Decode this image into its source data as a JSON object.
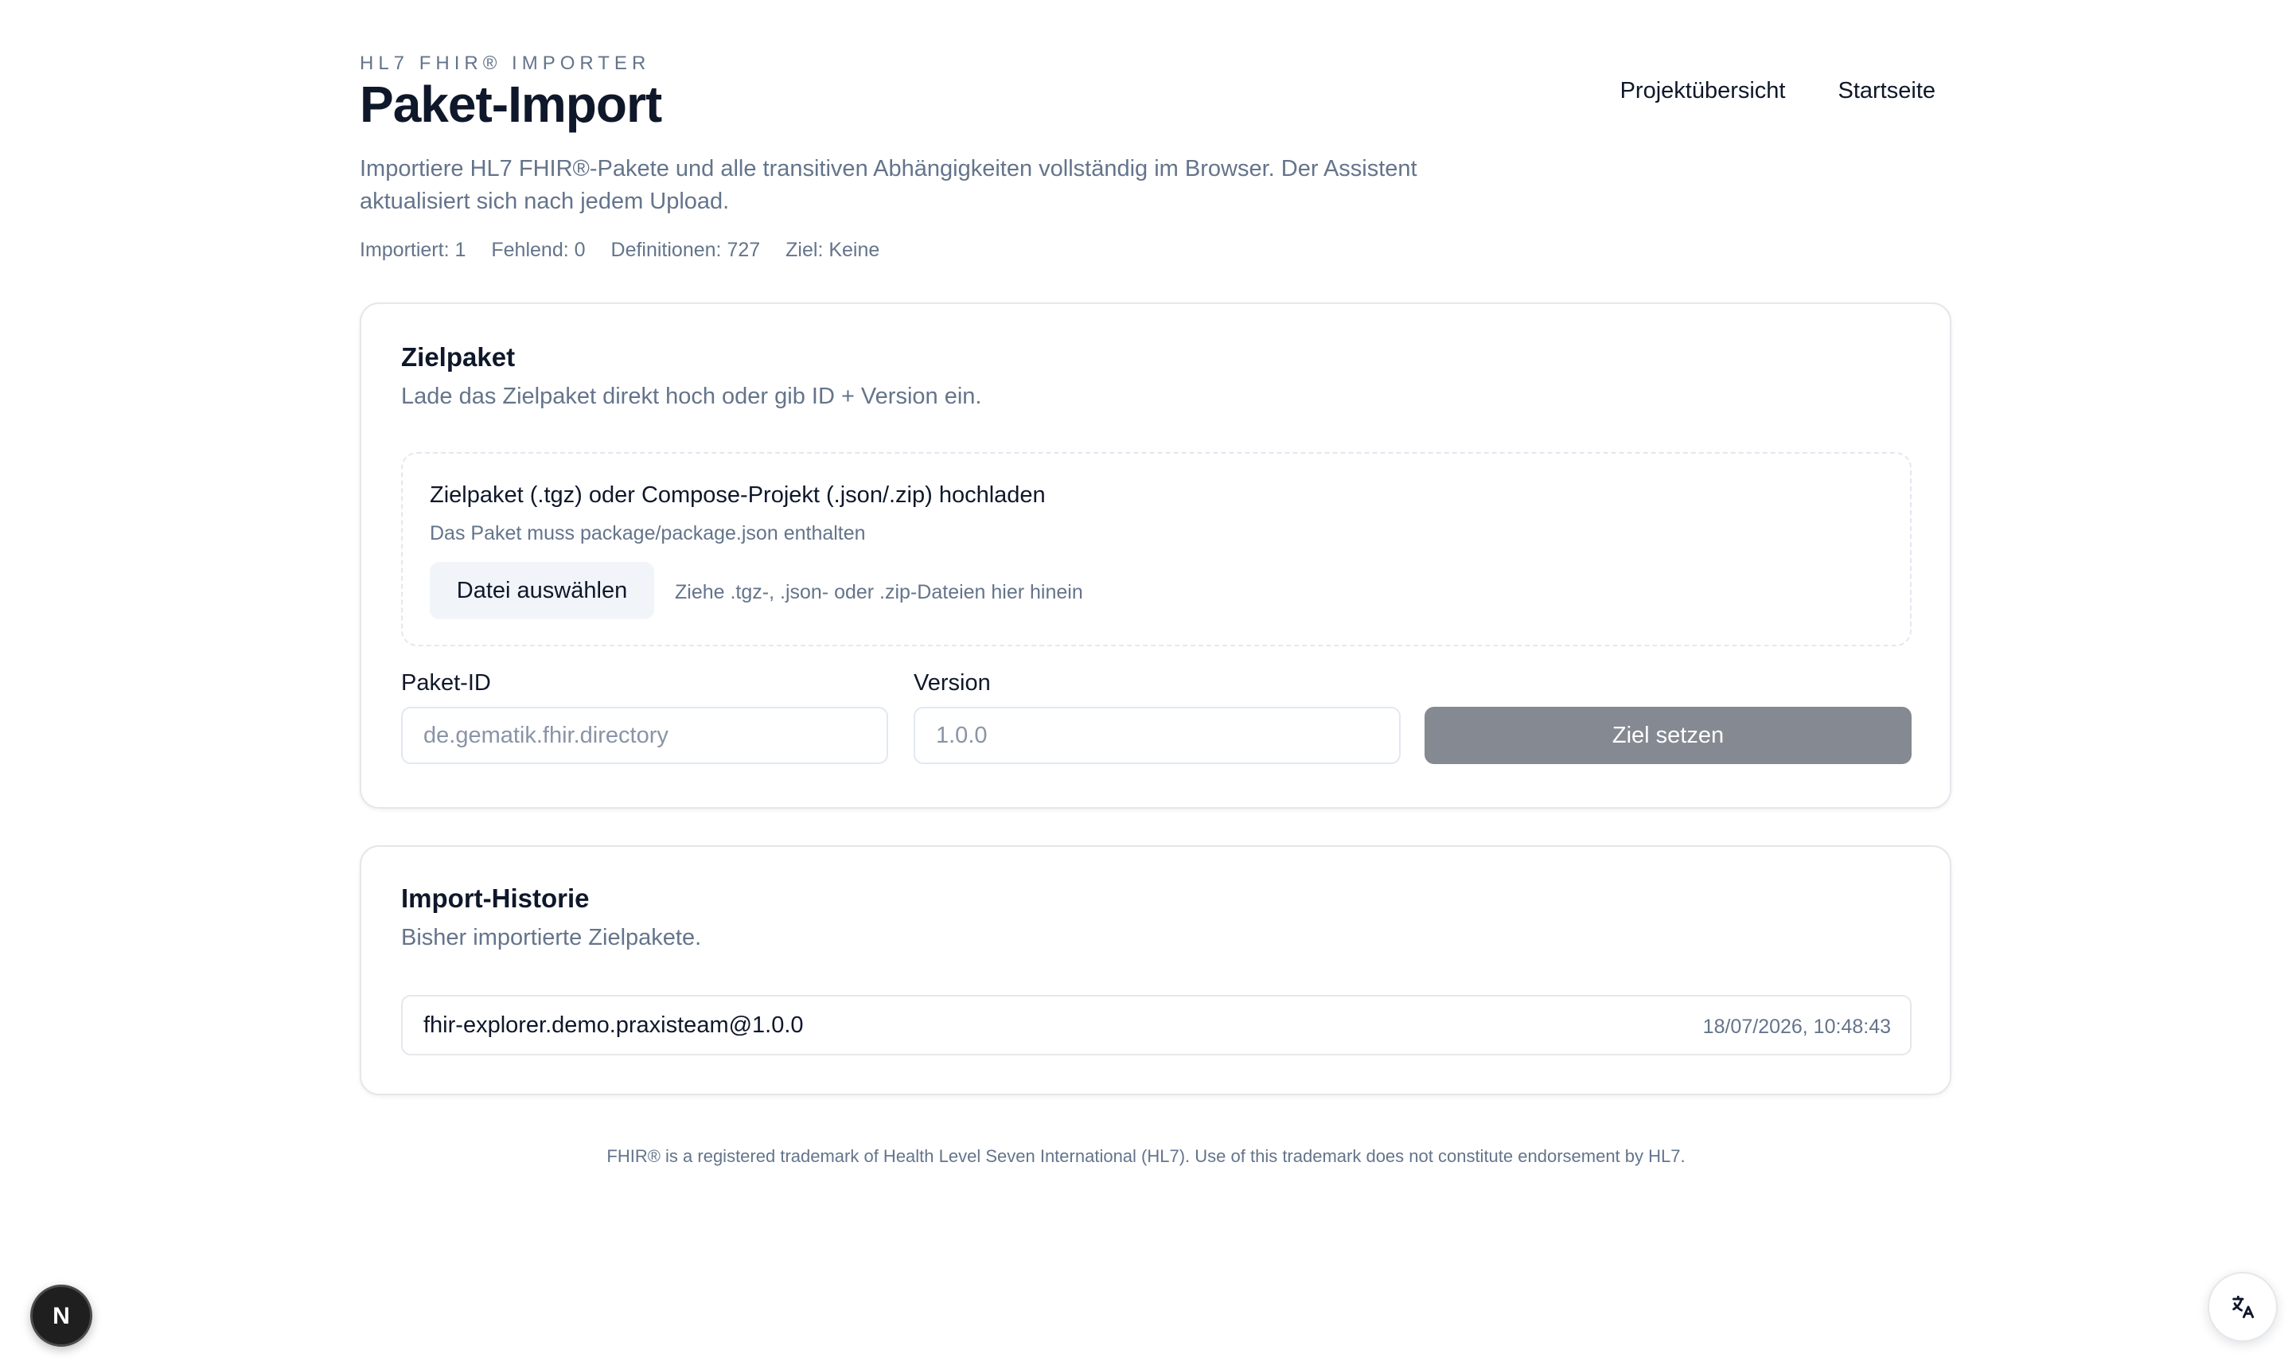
{
  "header": {
    "eyebrow": "HL7 FHIR® IMPORTER",
    "title": "Paket-Import",
    "nav": [
      {
        "label": "Projektübersicht"
      },
      {
        "label": "Startseite"
      }
    ],
    "intro": "Importiere HL7 FHIR®-Pakete und alle transitiven Abhängigkeiten vollständig im Browser. Der Assistent aktualisiert sich nach jedem Upload.",
    "stats": {
      "imported": "Importiert: 1",
      "missing": "Fehlend: 0",
      "definitions": "Definitionen: 727",
      "target": "Ziel: Keine"
    }
  },
  "target_card": {
    "title": "Zielpaket",
    "subtitle": "Lade das Zielpaket direkt hoch oder gib ID + Version ein.",
    "dropzone": {
      "title": "Zielpaket (.tgz) oder Compose-Projekt (.json/.zip) hochladen",
      "hint": "Das Paket muss package/package.json enthalten",
      "button_label": "Datei auswählen",
      "drop_text": "Ziehe .tgz-, .json- oder .zip-Dateien hier hinein"
    },
    "package_id": {
      "label": "Paket-ID",
      "placeholder": "de.gematik.fhir.directory"
    },
    "version": {
      "label": "Version",
      "placeholder": "1.0.0"
    },
    "submit_label": "Ziel setzen",
    "submit_color": "#858991"
  },
  "history_card": {
    "title": "Import-Historie",
    "subtitle": "Bisher importierte Zielpakete.",
    "items": [
      {
        "name": "fhir-explorer.demo.praxisteam@1.0.0",
        "timestamp": "18/07/2026, 10:48:43"
      }
    ]
  },
  "footer": {
    "text": "FHIR® is a registered trademark of Health Level Seven International (HL7). Use of this trademark does not constitute endorsement by HL7."
  },
  "widgets": {
    "next_badge_icon": "nextjs-logo-icon",
    "next_badge_letter": "N",
    "translate_icon": "translate-icon"
  }
}
